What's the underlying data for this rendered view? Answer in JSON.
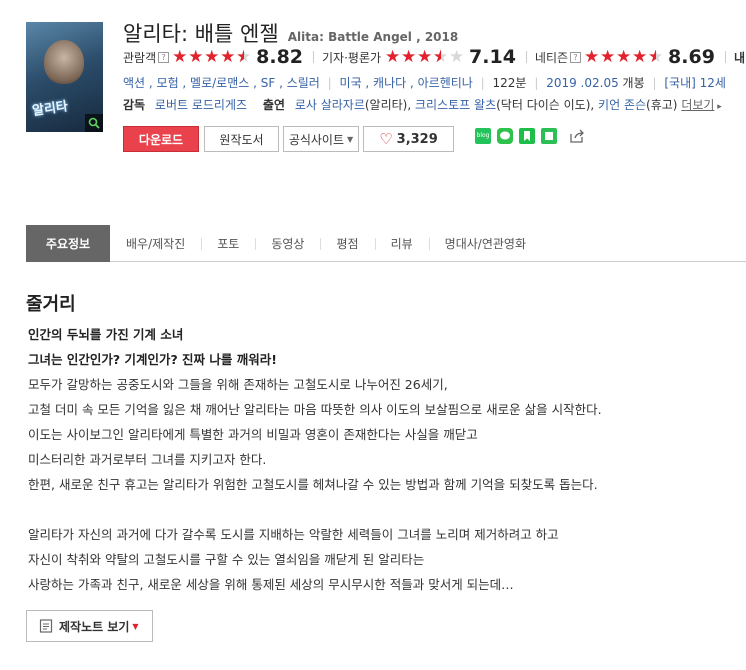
{
  "movie": {
    "title_ko": "알리타: 배틀 엔젤",
    "title_en": "Alita: Battle Angel , 2018",
    "poster_title": "알리타"
  },
  "ratings": [
    {
      "label": "관람객",
      "score": "8.82",
      "stars": 4.5,
      "has_help": true
    },
    {
      "label": "기자·평론가",
      "score": "7.14",
      "stars": 3.5,
      "has_help": false
    },
    {
      "label": "네티즌",
      "score": "8.69",
      "stars": 4.5,
      "has_help": true
    },
    {
      "label": "내 평",
      "score": "",
      "stars": 0,
      "has_help": false
    }
  ],
  "meta": {
    "genres": "액션 , 모험 , 멜로/로맨스 , SF , 스릴러",
    "countries": "미국 , 캐나다 , 아르헨티나",
    "runtime": "122분",
    "release": "2019 .02.05",
    "release_suffix": "개봉",
    "grade": "[국내] 12세"
  },
  "credits": {
    "director_label": "감독",
    "director": "로버트 로드리게즈",
    "cast_label": "출연",
    "cast_1": "로사 살라자르",
    "cast_1_role": "(알리타),",
    "cast_2": "크리스토프 왈츠",
    "cast_2_role": "(닥터 다이슨 이도),",
    "cast_3": "키언 존슨",
    "cast_3_role": "(휴고)",
    "more": "더보기"
  },
  "buttons": {
    "download": "다운로드",
    "book": "원작도서",
    "official": "공식사이트",
    "likes": "3,329",
    "blog": "blog"
  },
  "tabs": [
    "주요정보",
    "배우/제작진",
    "포토",
    "동영상",
    "평점",
    "리뷰",
    "명대사/연관영화"
  ],
  "synopsis": {
    "heading": "줄거리",
    "tagline1": "인간의 두뇌를 가진 기계 소녀",
    "tagline2": "그녀는 인간인가? 기계인가? 진짜 나를 깨워라!",
    "lines": [
      "모두가 갈망하는 공중도시와 그들을 위해 존재하는 고철도시로 나누어진 26세기,",
      " 고철 더미 속 모든 기억을 잃은 채 깨어난 알리타는 마음 따뜻한 의사 이도의 보살핌으로 새로운 삶을 시작한다.",
      " 이도는 사이보그인 알리타에게 특별한 과거의 비밀과 영혼이 존재한다는 사실을 깨닫고",
      " 미스터리한 과거로부터 그녀를 지키고자 한다.",
      " 한편, 새로운 친구 휴고는 알리타가 위험한 고철도시를 헤쳐나갈 수 있는 방법과 함께 기억을 되찾도록 돕는다.",
      "",
      " 알리타가 자신의 과거에 다가 갈수록 도시를 지배하는 악랄한 세력들이 그녀를 노리며 제거하려고 하고",
      " 자신이 착취와 약탈의 고철도시를 구할 수 있는 열쇠임을 깨닫게 된 알리타는",
      " 사랑하는 가족과 친구, 새로운 세상을 위해 통제된 세상의 무시무시한 적들과 맞서게 되는데…"
    ],
    "notes_button": "제작노트 보기"
  },
  "colors": {
    "accent_red": "#e0232e",
    "download_bg": "#e9424c",
    "link_blue": "#3662a6",
    "tab_active_bg": "#666666",
    "share_green": "#23c35a"
  }
}
